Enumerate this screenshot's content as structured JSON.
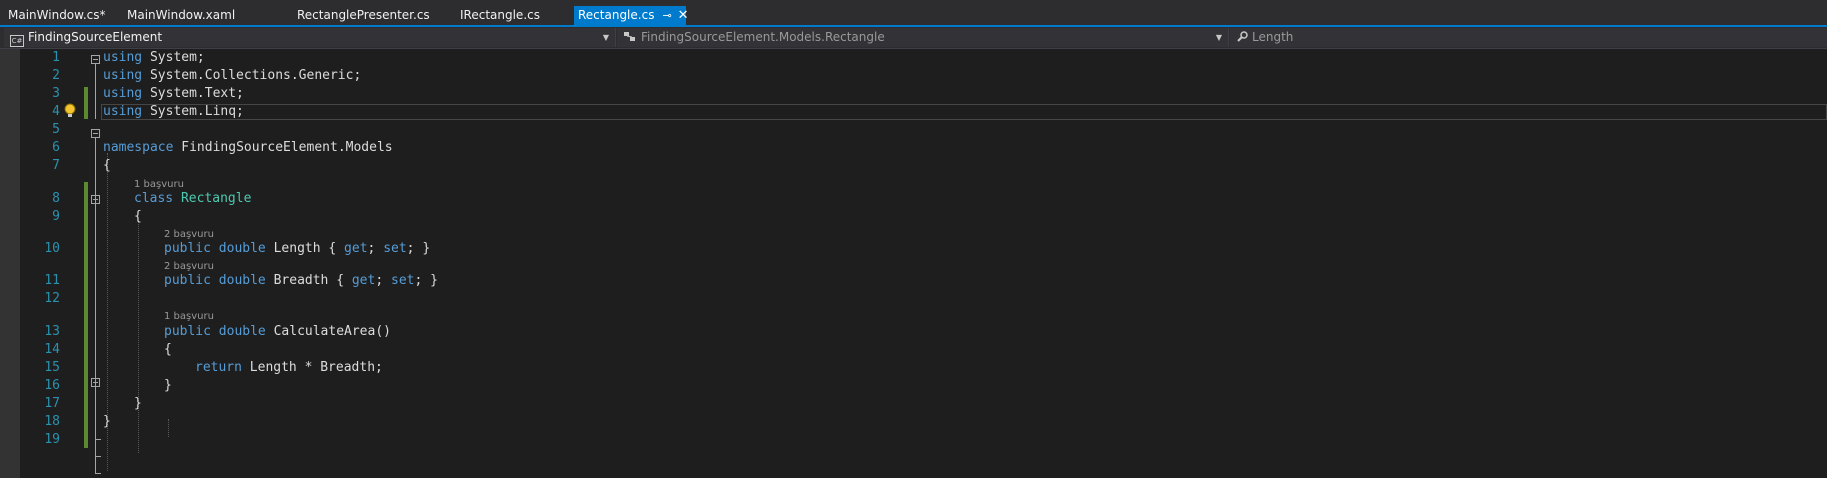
{
  "tabs": [
    {
      "label": "MainWindow.cs*"
    },
    {
      "label": "MainWindow.xaml"
    },
    {
      "label": "RectanglePresenter.cs"
    },
    {
      "label": "IRectangle.cs"
    },
    {
      "label": "Rectangle.cs",
      "active": true,
      "pin": "⊸",
      "close": "✕"
    }
  ],
  "navbar": {
    "project": "FindingSourceElement",
    "project_icon": "C#",
    "type": "FindingSourceElement.Models.Rectangle",
    "member": "Length"
  },
  "icons": {
    "csharp-project": "csharp-project-icon",
    "class": "class-icon",
    "wrench": "wrench-icon",
    "lightbulb": "lightbulb-icon"
  },
  "colors": {
    "accent": "#007acc",
    "keyword": "#569cd6",
    "type": "#4ec9b0",
    "line_number": "#2b91af",
    "change_bar": "#5c8a2f"
  },
  "lines": {
    "n1": "1",
    "n2": "2",
    "n3": "3",
    "n4": "4",
    "n5": "5",
    "n6": "6",
    "n7": "7",
    "n8": "8",
    "n9": "9",
    "n10": "10",
    "n11": "11",
    "n12": "12",
    "n13": "13",
    "n14": "14",
    "n15": "15",
    "n16": "16",
    "n17": "17",
    "n18": "18",
    "n19": "19"
  },
  "code": {
    "using": "using",
    "ns_system": " System;",
    "ns_generic": " System.Collections.Generic;",
    "ns_text": " System.Text;",
    "ns_linq": " System.Linq;",
    "namespace_kw": "namespace",
    "namespace_name": " FindingSourceElement.Models",
    "open_brace": "{",
    "close_brace": "}",
    "class_kw": "class",
    "class_name": "Rectangle",
    "public_kw": "public",
    "double_kw": "double",
    "length_name": " Length { ",
    "breadth_name": " Breadth { ",
    "get_kw": "get",
    "set_kw": "set",
    "semi_sp": "; ",
    "semi_close": "; }",
    "method_name": " CalculateArea()",
    "return_kw": "return",
    "return_expr": " Length * Breadth;"
  },
  "references": {
    "class_refs": "1 başvuru",
    "length_refs": "2 başvuru",
    "breadth_refs": "2 başvuru",
    "method_refs": "1 başvuru"
  }
}
